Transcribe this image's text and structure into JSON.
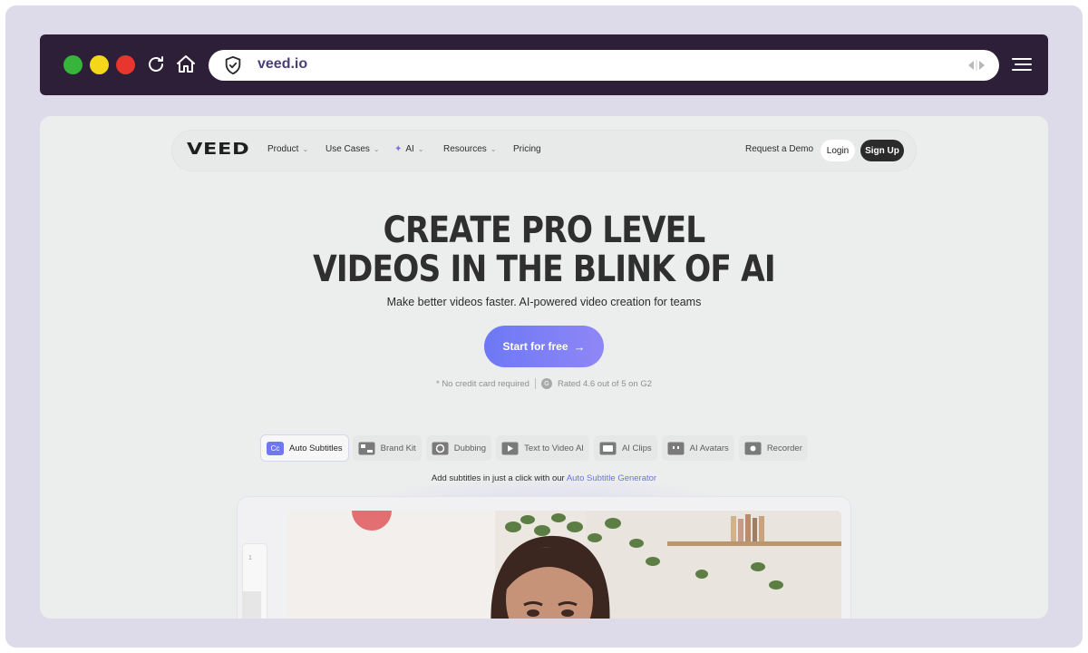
{
  "browser": {
    "url": "veed.io"
  },
  "nav": {
    "logo": "VEED",
    "items": [
      {
        "label": "Product"
      },
      {
        "label": "Use Cases"
      },
      {
        "label": "AI"
      },
      {
        "label": "Resources"
      },
      {
        "label": "Pricing"
      }
    ],
    "request_demo": "Request a Demo",
    "login": "Login",
    "signup": "Sign Up"
  },
  "hero": {
    "title_line1": "CREATE PRO LEVEL",
    "title_line2": "VIDEOS IN THE BLINK OF AI",
    "subtitle": "Make better videos faster. AI-powered video creation for teams",
    "cta": "Start for free",
    "no_card": "* No credit card required",
    "rating": "Rated 4.6 out of 5 on G2"
  },
  "feature_tabs": [
    {
      "label": "Auto Subtitles",
      "icon": "Cc",
      "active": true
    },
    {
      "label": "Brand Kit",
      "icon": "brand-kit-icon"
    },
    {
      "label": "Dubbing",
      "icon": "dubbing-icon"
    },
    {
      "label": "Text to Video AI",
      "icon": "text-to-video-icon"
    },
    {
      "label": "AI Clips",
      "icon": "clips-icon"
    },
    {
      "label": "AI Avatars",
      "icon": "avatar-icon"
    },
    {
      "label": "Recorder",
      "icon": "recorder-icon"
    }
  ],
  "caption": {
    "text": "Add subtitles in just a click with our",
    "link": "Auto Subtitle Generator"
  },
  "editor_preview": {
    "line_number": "1"
  },
  "colors": {
    "browser_bar": "#2e1f38",
    "frame": "#dddbea",
    "accent": "#6d78f5",
    "page_bg": "#eceded"
  }
}
